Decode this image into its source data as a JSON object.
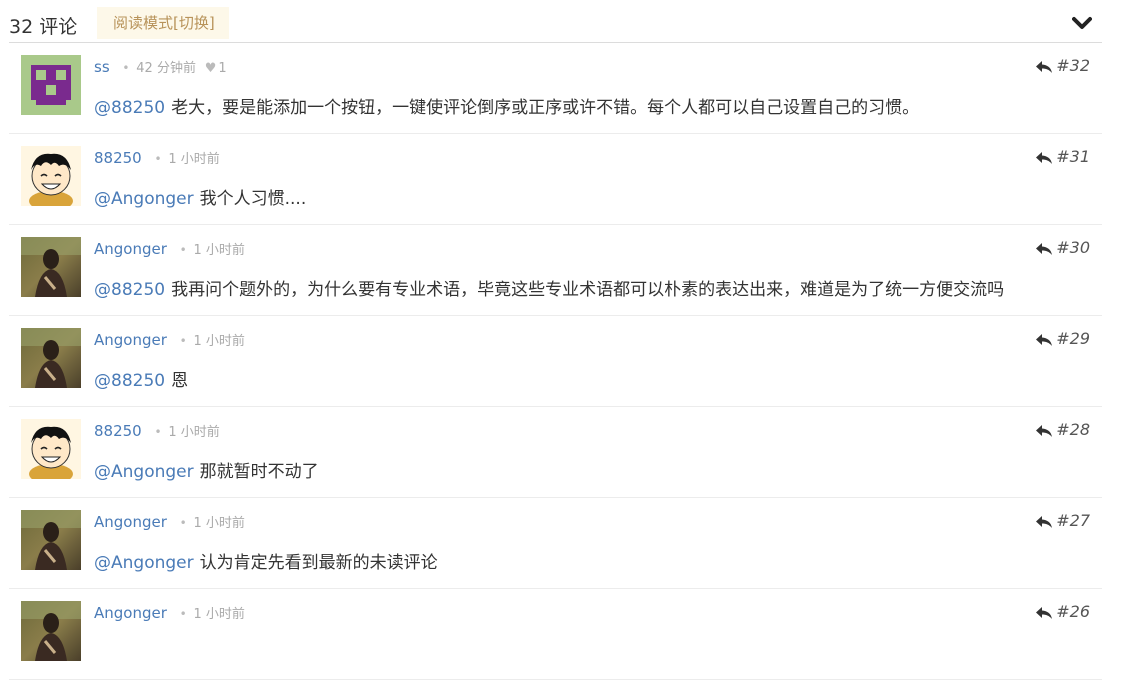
{
  "header": {
    "count_label": "32 评论",
    "read_mode_label": "阅读模式[切换]"
  },
  "comments": [
    {
      "author": "ss",
      "time": "42 分钟前",
      "likes": "1",
      "mention": "@88250",
      "text": "老大，要是能添加一个按钮，一键使评论倒序或正序或许不错。每个人都可以自己设置自己的习惯。",
      "number": "#32",
      "avatar": "pixel"
    },
    {
      "author": "88250",
      "time": "1 小时前",
      "mention": "@Angonger",
      "text": "我个人习惯....",
      "number": "#31",
      "avatar": "cartoon"
    },
    {
      "author": "Angonger",
      "time": "1 小时前",
      "mention": "@88250",
      "text": "我再问个题外的，为什么要有专业术语，毕竟这些专业术语都可以朴素的表达出来，难道是为了统一方便交流吗",
      "number": "#30",
      "avatar": "photo"
    },
    {
      "author": "Angonger",
      "time": "1 小时前",
      "mention": "@88250",
      "text": "恩",
      "number": "#29",
      "avatar": "photo"
    },
    {
      "author": "88250",
      "time": "1 小时前",
      "mention": "@Angonger",
      "text": "那就暂时不动了",
      "number": "#28",
      "avatar": "cartoon"
    },
    {
      "author": "Angonger",
      "time": "1 小时前",
      "mention": "@Angonger",
      "text": "认为肯定先看到最新的未读评论",
      "number": "#27",
      "avatar": "photo"
    },
    {
      "author": "Angonger",
      "time": "1 小时前",
      "mention": "",
      "text": "",
      "number": "#26",
      "avatar": "photo"
    }
  ],
  "colors": {
    "link": "#4a7bb7",
    "read_mode_bg": "#fdf8e9",
    "read_mode_text": "#b8935a"
  },
  "icons": {
    "collapse": "chevron-down-icon",
    "reply": "reply-icon",
    "like": "heart-icon"
  }
}
